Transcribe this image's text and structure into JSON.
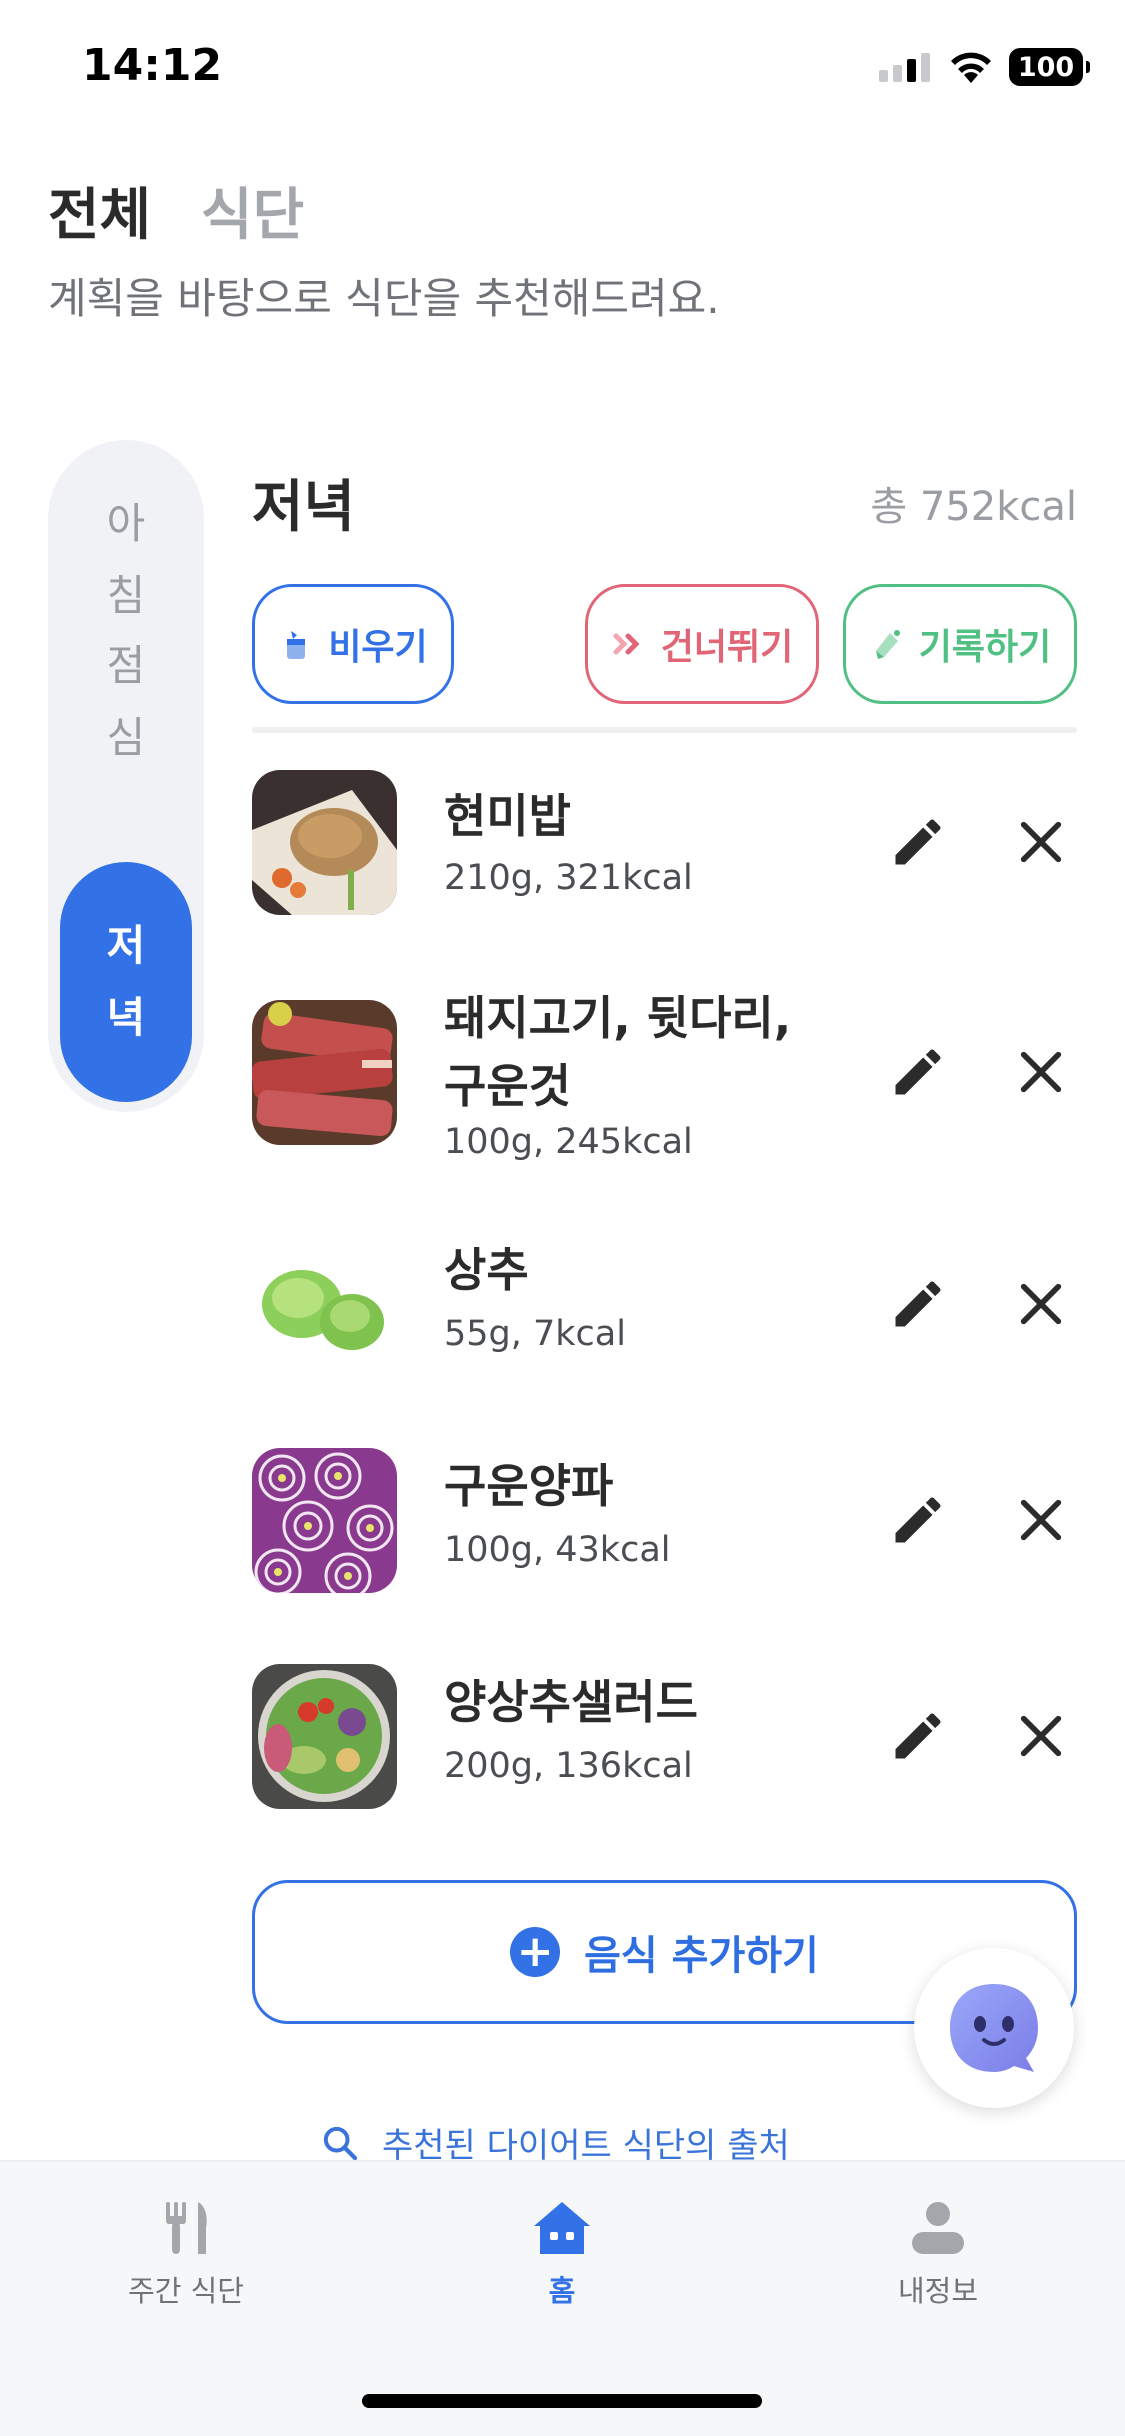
{
  "status": {
    "time": "14:12",
    "battery": "100"
  },
  "top_tabs": [
    {
      "label": "전체",
      "active": true
    },
    {
      "label": "식단",
      "active": false
    }
  ],
  "subtitle": "계획을 바탕으로 식단을 추천해드려요.",
  "meal_tabs": [
    {
      "label": [
        "아",
        "침"
      ],
      "active": false
    },
    {
      "label": [
        "점",
        "심"
      ],
      "active": false
    },
    {
      "label": [
        "저",
        "녁"
      ],
      "active": true
    }
  ],
  "meal": {
    "title": "저녁",
    "total": "총 752kcal"
  },
  "actions": {
    "empty": "비우기",
    "skip": "건너뛰기",
    "record": "기록하기"
  },
  "foods": [
    {
      "name": "현미밥",
      "detail": "210g, 321kcal",
      "image": "brown-rice"
    },
    {
      "name": "돼지고기, 뒷다리, 구운것",
      "name_lines": [
        "돼지고기, 뒷다리,",
        "구운것"
      ],
      "detail": "100g, 245kcal",
      "image": "pork"
    },
    {
      "name": "상추",
      "detail": "55g, 7kcal",
      "image": "lettuce"
    },
    {
      "name": "구운양파",
      "detail": "100g, 43kcal",
      "image": "onion"
    },
    {
      "name": "양상추샐러드",
      "detail": "200g, 136kcal",
      "image": "salad"
    }
  ],
  "add_food": "음식 추가하기",
  "source_link": "추천된 다이어트 식단의 출처",
  "bottom_nav": [
    {
      "label": "주간 식단",
      "icon": "fork-knife-icon",
      "active": false
    },
    {
      "label": "홈",
      "icon": "home-icon",
      "active": true
    },
    {
      "label": "내정보",
      "icon": "person-icon",
      "active": false
    }
  ],
  "colors": {
    "primary": "#3272e6",
    "skip": "#e06577",
    "record": "#4fbf82",
    "inactive": "#9a9da2"
  }
}
